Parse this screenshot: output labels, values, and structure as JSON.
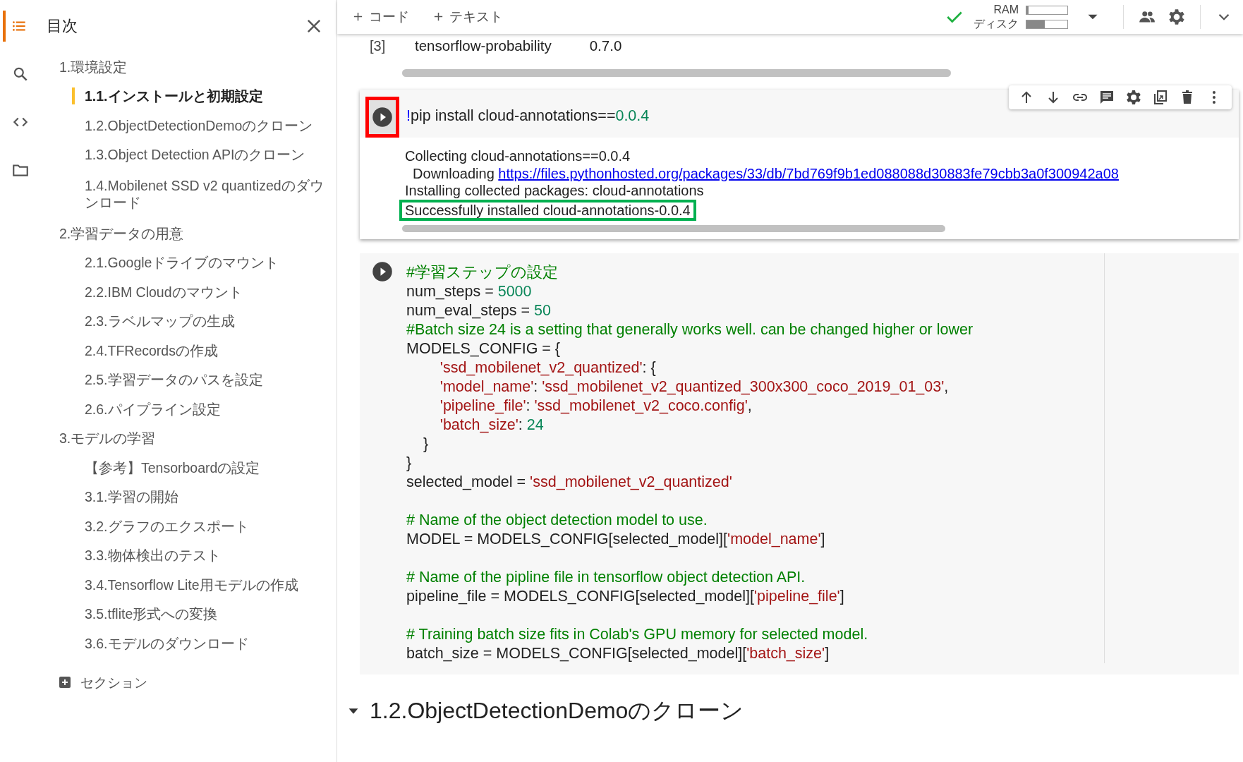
{
  "toc": {
    "title": "目次",
    "items": [
      {
        "label": "1.環境設定",
        "selected": false,
        "children": [
          {
            "label": "1.1.インストールと初期設定",
            "selected": true
          },
          {
            "label": "1.2.ObjectDetectionDemoのクローン",
            "selected": false
          },
          {
            "label": "1.3.Object Detection APIのクローン",
            "selected": false
          },
          {
            "label": "1.4.Mobilenet SSD v2 quantizedのダウンロード",
            "selected": false
          }
        ]
      },
      {
        "label": "2.学習データの用意",
        "selected": false,
        "children": [
          {
            "label": "2.1.Googleドライブのマウント",
            "selected": false
          },
          {
            "label": "2.2.IBM Cloudのマウント",
            "selected": false
          },
          {
            "label": "2.3.ラベルマップの生成",
            "selected": false
          },
          {
            "label": "2.4.TFRecordsの作成",
            "selected": false
          },
          {
            "label": "2.5.学習データのパスを設定",
            "selected": false
          },
          {
            "label": "2.6.パイプライン設定",
            "selected": false
          }
        ]
      },
      {
        "label": "3.モデルの学習",
        "selected": false,
        "children": [
          {
            "label": "【参考】Tensorboardの設定",
            "selected": false
          },
          {
            "label": "3.1.学習の開始",
            "selected": false
          },
          {
            "label": "3.2.グラフのエクスポート",
            "selected": false
          },
          {
            "label": "3.3.物体検出のテスト",
            "selected": false
          },
          {
            "label": "3.4.Tensorflow Lite用モデルの作成",
            "selected": false
          },
          {
            "label": "3.5.tflite形式への変換",
            "selected": false
          },
          {
            "label": "3.6.モデルのダウンロード",
            "selected": false
          }
        ]
      }
    ],
    "add_section": "セクション"
  },
  "toolbar": {
    "buttons": [
      "コード",
      "テキスト"
    ],
    "ram": {
      "label": "RAM",
      "level": 0.05
    },
    "disk": {
      "label": "ディスク",
      "level": 0.45
    }
  },
  "previous_output": {
    "exec_count": "[3]",
    "rows": [
      [
        "tensorflow-probability",
        "0.7.0"
      ]
    ]
  },
  "cells": [
    {
      "focused": true,
      "run_boxed": true,
      "code": [
        {
          "parts": [
            {
              "kind": "magic",
              "text": "!"
            },
            {
              "kind": "plain",
              "text": "pip install cloud-annotations=="
            },
            {
              "kind": "number",
              "text": "0.0.4"
            }
          ]
        }
      ],
      "output": [
        {
          "boxed": false,
          "parts": [
            {
              "kind": "plain",
              "text": "Collecting cloud-annotations==0.0.4"
            }
          ]
        },
        {
          "boxed": false,
          "parts": [
            {
              "kind": "plain",
              "text": "  Downloading "
            },
            {
              "kind": "link",
              "text": "https://files.pythonhosted.org/packages/33/db/7bd769f9b1ed088088d30883fe79cbb3a0f300942a08"
            }
          ]
        },
        {
          "boxed": false,
          "parts": [
            {
              "kind": "plain",
              "text": "Installing collected packages: cloud-annotations"
            }
          ]
        },
        {
          "boxed": true,
          "parts": [
            {
              "kind": "plain",
              "text": "Successfully installed cloud-annotations-0.0.4"
            }
          ]
        }
      ]
    },
    {
      "focused": false,
      "run_boxed": false,
      "code": [
        {
          "parts": [
            {
              "kind": "comment",
              "text": "#学習ステップの設定"
            }
          ]
        },
        {
          "parts": [
            {
              "kind": "plain",
              "text": "num_steps = "
            },
            {
              "kind": "number",
              "text": "5000"
            }
          ]
        },
        {
          "parts": [
            {
              "kind": "plain",
              "text": "num_eval_steps = "
            },
            {
              "kind": "number",
              "text": "50"
            }
          ]
        },
        {
          "parts": [
            {
              "kind": "comment",
              "text": "#Batch size 24 is a setting that generally works well. can be changed higher or lower"
            }
          ]
        },
        {
          "parts": [
            {
              "kind": "plain",
              "text": "MODELS_CONFIG = {"
            }
          ]
        },
        {
          "parts": [
            {
              "kind": "string",
              "text": "        'ssd_mobilenet_v2_quantized'"
            },
            {
              "kind": "plain",
              "text": ": {"
            }
          ]
        },
        {
          "parts": [
            {
              "kind": "string",
              "text": "        'model_name'"
            },
            {
              "kind": "plain",
              "text": ": "
            },
            {
              "kind": "string",
              "text": "'ssd_mobilenet_v2_quantized_300x300_coco_2019_01_03'"
            },
            {
              "kind": "plain",
              "text": ","
            }
          ]
        },
        {
          "parts": [
            {
              "kind": "string",
              "text": "        'pipeline_file'"
            },
            {
              "kind": "plain",
              "text": ": "
            },
            {
              "kind": "string",
              "text": "'ssd_mobilenet_v2_coco.config'"
            },
            {
              "kind": "plain",
              "text": ","
            }
          ]
        },
        {
          "parts": [
            {
              "kind": "string",
              "text": "        'batch_size'"
            },
            {
              "kind": "plain",
              "text": ": "
            },
            {
              "kind": "number",
              "text": "24"
            }
          ]
        },
        {
          "parts": [
            {
              "kind": "plain",
              "text": "    }"
            }
          ]
        },
        {
          "parts": [
            {
              "kind": "plain",
              "text": "}"
            }
          ]
        },
        {
          "parts": [
            {
              "kind": "plain",
              "text": "selected_model = "
            },
            {
              "kind": "string",
              "text": "'ssd_mobilenet_v2_quantized'"
            }
          ]
        },
        {
          "kind": "blank"
        },
        {
          "parts": [
            {
              "kind": "comment",
              "text": "# Name of the object detection model to use."
            }
          ]
        },
        {
          "parts": [
            {
              "kind": "plain",
              "text": "MODEL = MODELS_CONFIG[selected_model]["
            },
            {
              "kind": "string",
              "text": "'model_name'"
            },
            {
              "kind": "plain",
              "text": "]"
            }
          ]
        },
        {
          "kind": "blank"
        },
        {
          "parts": [
            {
              "kind": "comment",
              "text": "# Name of the pipline file in tensorflow object detection API."
            }
          ]
        },
        {
          "parts": [
            {
              "kind": "plain",
              "text": "pipeline_file = MODELS_CONFIG[selected_model]["
            },
            {
              "kind": "string",
              "text": "'pipeline_file'"
            },
            {
              "kind": "plain",
              "text": "]"
            }
          ]
        },
        {
          "kind": "blank"
        },
        {
          "parts": [
            {
              "kind": "comment",
              "text": "# Training batch size fits in Colab's GPU memory for selected model."
            }
          ]
        },
        {
          "parts": [
            {
              "kind": "plain",
              "text": "batch_size = MODELS_CONFIG[selected_model]["
            },
            {
              "kind": "string",
              "text": "'batch_size'"
            },
            {
              "kind": "plain",
              "text": "]"
            }
          ]
        }
      ]
    }
  ],
  "heading": {
    "text": "1.2.ObjectDetectionDemoのクローン",
    "expanded": true
  }
}
